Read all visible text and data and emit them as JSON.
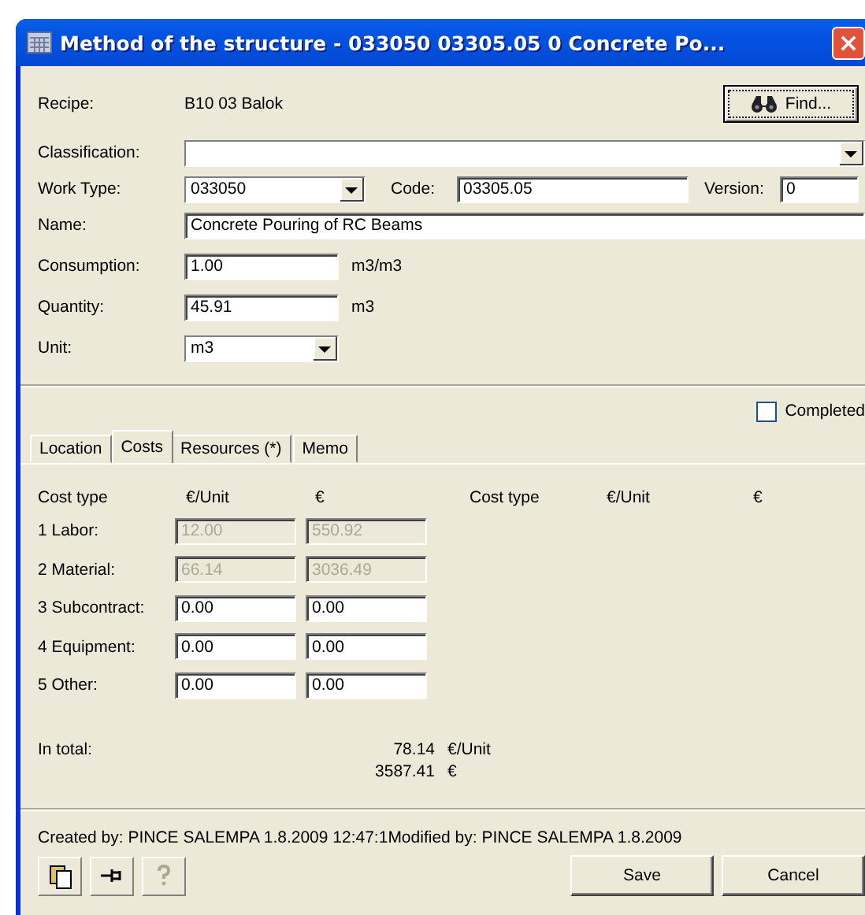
{
  "window": {
    "title": "Method of the structure - 033050 03305.05 0 Concrete Po..."
  },
  "recipe": {
    "label": "Recipe:",
    "value": "B10 03 Balok"
  },
  "find_button": {
    "label": "Find..."
  },
  "classification": {
    "label": "Classification:"
  },
  "work_type": {
    "label": "Work Type:",
    "value": "033050"
  },
  "code": {
    "label": "Code:",
    "value": "03305.05"
  },
  "version": {
    "label": "Version:",
    "value": "0"
  },
  "name": {
    "label": "Name:",
    "value": "Concrete Pouring of RC Beams"
  },
  "consumption": {
    "label": "Consumption:",
    "value": "1.00",
    "unit": "m3/m3"
  },
  "quantity": {
    "label": "Quantity:",
    "value": "45.91",
    "unit": "m3"
  },
  "unit": {
    "label": "Unit:",
    "value": "m3"
  },
  "completed": {
    "label": "Completed",
    "checked": false
  },
  "tabs": [
    {
      "label": "Location",
      "selected": false
    },
    {
      "label": "Costs",
      "selected": true
    },
    {
      "label": "Resources (*)",
      "selected": false
    },
    {
      "label": "Memo",
      "selected": false
    }
  ],
  "costs": {
    "headers": [
      "Cost type",
      "€/Unit",
      "€",
      "Cost type",
      "€/Unit",
      "€"
    ],
    "rows": [
      {
        "label": "1 Labor:",
        "per_unit": "12.00",
        "total": "550.92",
        "disabled": true
      },
      {
        "label": "2 Material:",
        "per_unit": "66.14",
        "total": "3036.49",
        "disabled": true
      },
      {
        "label": "3 Subcontract:",
        "per_unit": "0.00",
        "total": "0.00",
        "disabled": false
      },
      {
        "label": "4 Equipment:",
        "per_unit": "0.00",
        "total": "0.00",
        "disabled": false
      },
      {
        "label": "5 Other:",
        "per_unit": "0.00",
        "total": "0.00",
        "disabled": false
      }
    ],
    "total": {
      "label": "In total:",
      "per_unit": "78.14",
      "per_unit_suffix": "€/Unit",
      "total": "3587.41",
      "total_suffix": "€"
    }
  },
  "status": {
    "created": "Created by: PINCE SALEMPA 1.8.2009 12:47:1",
    "modified": "Modified by: PINCE SALEMPA 1.8.2009"
  },
  "toolbar": [
    {
      "kind": "copy",
      "disabled": false
    },
    {
      "kind": "pin",
      "disabled": false
    },
    {
      "kind": "help",
      "disabled": true
    }
  ],
  "buttons": [
    "Save",
    "Cancel"
  ]
}
